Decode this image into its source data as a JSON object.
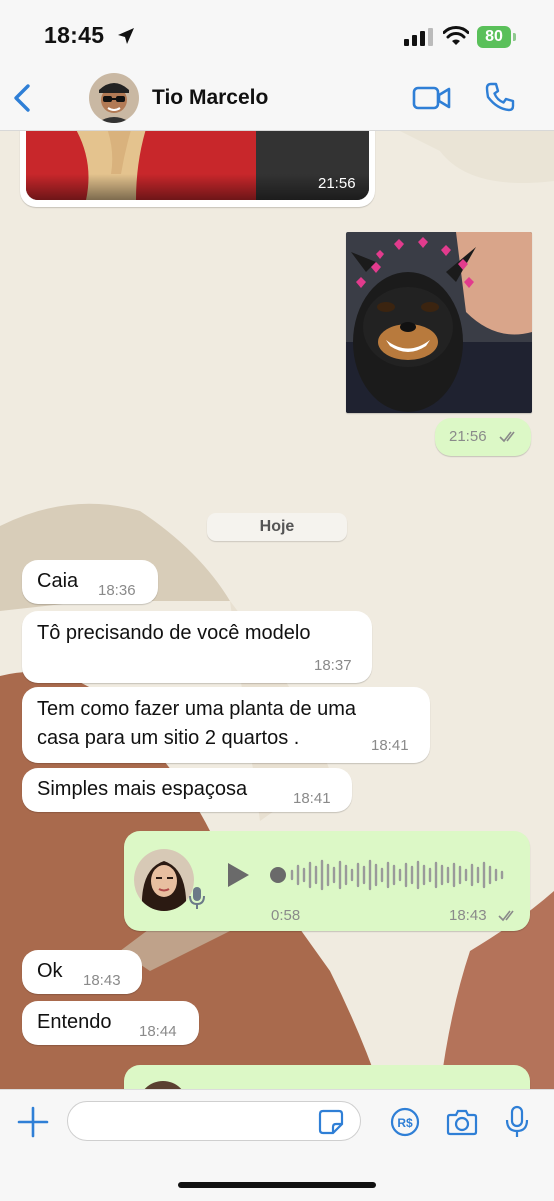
{
  "status": {
    "time": "18:45",
    "battery": "80"
  },
  "header": {
    "contact_name": "Tio Marcelo",
    "back_icon": "chevron-left-icon",
    "video_icon": "video-call-icon",
    "call_icon": "phone-icon"
  },
  "messages": {
    "m1": {
      "time": "21:56"
    },
    "m2": {
      "time": "21:56",
      "status": "read"
    },
    "day_separator": "Hoje",
    "m3": {
      "text": "Caia",
      "time": "18:36"
    },
    "m4": {
      "text": "Tô precisando de você modelo",
      "time": "18:37"
    },
    "m5": {
      "line1": "Tem como fazer uma planta de uma",
      "line2": "casa para um sitio 2 quartos .",
      "time": "18:41"
    },
    "m6": {
      "text": "Simples mais espaçosa",
      "time": "18:41"
    },
    "m7": {
      "duration": "0:58",
      "time": "18:43",
      "status": "read"
    },
    "m8": {
      "text": "Ok",
      "time": "18:43"
    },
    "m9": {
      "text": "Entendo",
      "time": "18:44"
    }
  },
  "input": {
    "placeholder": ""
  },
  "colors": {
    "accent": "#2f7fd6",
    "outgoing_bubble": "#dcf8c6",
    "incoming_bubble": "#ffffff",
    "battery": "#5ac05a"
  }
}
